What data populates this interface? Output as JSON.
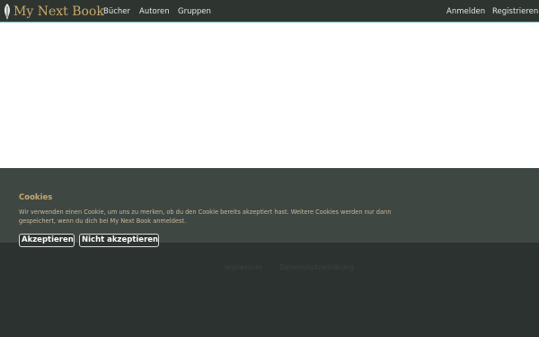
{
  "navbar": {
    "brand": "My Next Book",
    "links": [
      "Bücher",
      "Autoren",
      "Gruppen"
    ],
    "login": "Anmelden",
    "register": "Registrieren"
  },
  "footer": {
    "links": [
      "Impressum",
      "Datenschutzerklärung"
    ]
  },
  "cookie_banner": {
    "title": "Cookies",
    "text": "Wir verwenden einen Cookie, um uns zu merken, ob du den Cookie bereits akzeptiert hast. Weitere Cookies werden nur dann gespeichert, wenn du dich bei My Next Book anmeldest.",
    "accept_label": "Akzeptieren",
    "decline_label": "Nicht akzeptieren"
  }
}
